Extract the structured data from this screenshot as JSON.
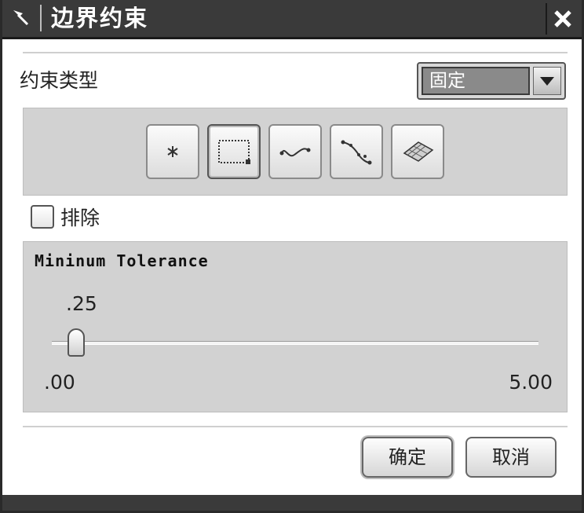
{
  "window": {
    "title": "边界约束"
  },
  "constraint": {
    "label": "约束类型",
    "selected": "固定"
  },
  "filters": [
    "point",
    "rectangle",
    "curve",
    "spline",
    "surface"
  ],
  "exclude": {
    "label": "排除",
    "checked": false
  },
  "tolerance": {
    "title": "Mininum Tolerance",
    "value_label": ".25",
    "value": 0.25,
    "min_label": ".00",
    "max_label": "5.00",
    "min": 0,
    "max": 5
  },
  "buttons": {
    "ok": "确定",
    "cancel": "取消"
  },
  "colors": {
    "titlebar": "#3a3a3a",
    "panel": "#d2d2d2",
    "select_value_bg": "#8a8a8a"
  }
}
